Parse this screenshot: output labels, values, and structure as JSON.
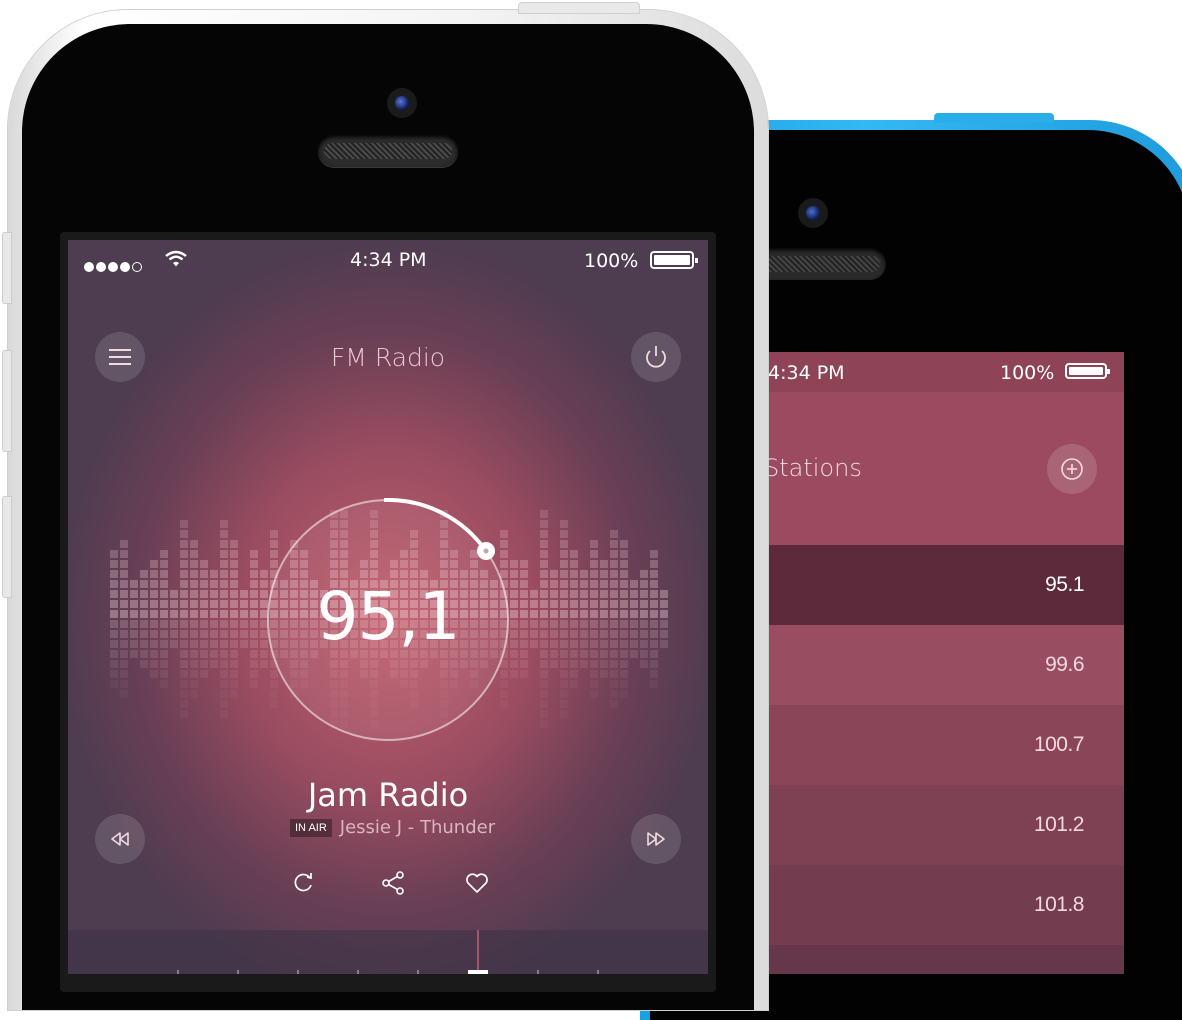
{
  "front_screen": {
    "status": {
      "time": "4:34 PM",
      "battery": "100%",
      "signal_dots": 5,
      "signal_filled": 4
    },
    "title": "FM Radio",
    "frequency": "95,1",
    "station_name": "Jam Radio",
    "in_air_label": "IN AIR",
    "now_playing": "Jessie J - Thunder",
    "icons": {
      "menu": "hamburger-menu-icon",
      "power": "power-icon",
      "rewind": "rewind-icon",
      "fast_forward": "fast-forward-icon",
      "repeat": "repeat-icon",
      "share": "share-icon",
      "favorite": "heart-icon"
    }
  },
  "back_screen": {
    "status": {
      "time": "4:34 PM",
      "battery": "100%"
    },
    "title": "Stations",
    "add_icon": "add-circle-icon",
    "stations": [
      {
        "freq": "95.1",
        "selected": true
      },
      {
        "freq": "99.6",
        "selected": false
      },
      {
        "freq": "100.7",
        "selected": false
      },
      {
        "freq": "101.2",
        "selected": false
      },
      {
        "freq": "101.8",
        "selected": false
      }
    ]
  },
  "colors": {
    "accent": "#c2606f",
    "back_phone": "#34b8f3",
    "selected_row": "#5c2a3a"
  }
}
